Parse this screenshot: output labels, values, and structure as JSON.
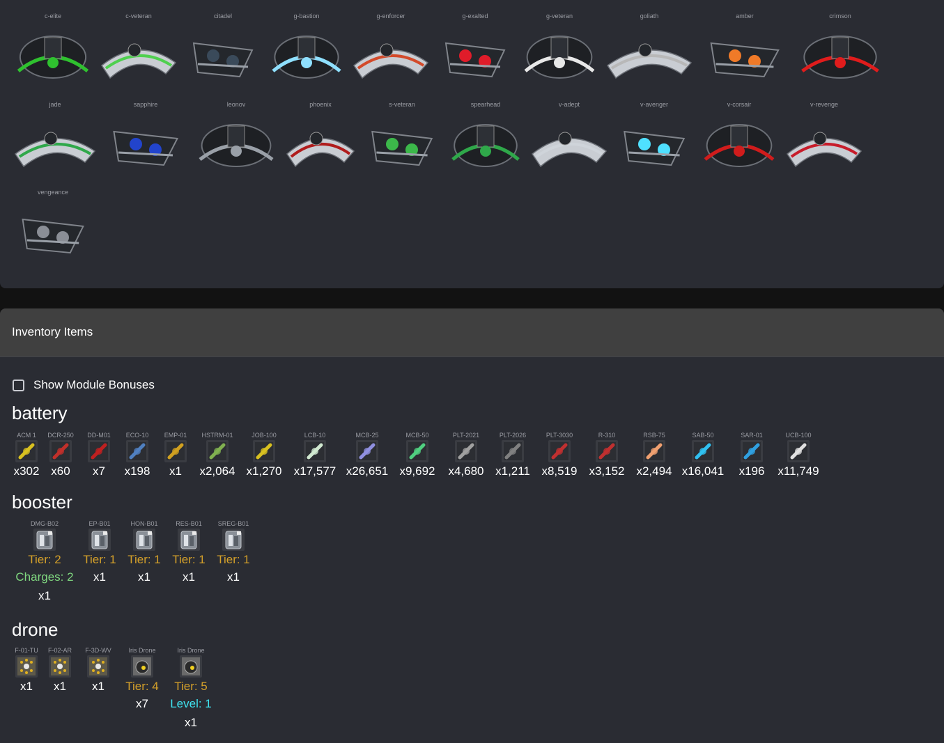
{
  "colors": {
    "panel": "#2a2c33",
    "header": "#404040",
    "tier": "#d4a02a",
    "charges": "#7fd67f",
    "level": "#3fe3f0"
  },
  "ships": {
    "row1": [
      {
        "name": "c-elite",
        "icon": "ship-icon",
        "accent": "#2fc12f"
      },
      {
        "name": "c-veteran",
        "icon": "ship-icon",
        "accent": "#4fd04f"
      },
      {
        "name": "citadel",
        "icon": "ship-icon",
        "accent": "#3a4a5a"
      },
      {
        "name": "g-bastion",
        "icon": "ship-icon",
        "accent": "#8fe0ff"
      },
      {
        "name": "g-enforcer",
        "icon": "ship-icon",
        "accent": "#d34a2a"
      },
      {
        "name": "g-exalted",
        "icon": "ship-icon",
        "accent": "#e01c2a"
      },
      {
        "name": "g-veteran",
        "icon": "ship-icon",
        "accent": "#e8e8e8"
      },
      {
        "name": "goliath",
        "icon": "ship-icon",
        "accent": "#b8b8b8"
      },
      {
        "name": "amber",
        "icon": "ship-icon",
        "accent": "#f07a28"
      },
      {
        "name": "crimson",
        "icon": "ship-icon",
        "accent": "#e01c1c"
      }
    ],
    "row2": [
      {
        "name": "jade",
        "icon": "ship-icon",
        "accent": "#2fa84a"
      },
      {
        "name": "sapphire",
        "icon": "ship-icon",
        "accent": "#2244cc"
      },
      {
        "name": "leonov",
        "icon": "ship-icon",
        "accent": "#9aa0a8"
      },
      {
        "name": "phoenix",
        "icon": "ship-icon",
        "accent": "#b01c1c"
      },
      {
        "name": "s-veteran",
        "icon": "ship-icon",
        "accent": "#3cb84a"
      },
      {
        "name": "spearhead",
        "icon": "ship-icon",
        "accent": "#2fa84a"
      },
      {
        "name": "v-adept",
        "icon": "ship-icon",
        "accent": "#cfd4da"
      },
      {
        "name": "v-avenger",
        "icon": "ship-icon",
        "accent": "#4fe0ff"
      },
      {
        "name": "v-corsair",
        "icon": "ship-icon",
        "accent": "#d01c1c"
      },
      {
        "name": "v-revenge",
        "icon": "ship-icon",
        "accent": "#c81c2a"
      }
    ],
    "row3": [
      {
        "name": "vengeance",
        "icon": "ship-icon",
        "accent": "#8a8e96"
      }
    ]
  },
  "inventory": {
    "title": "Inventory Items",
    "show_bonuses_label": "Show Module Bonuses",
    "battery": {
      "title": "battery",
      "items": [
        {
          "label": "ACM 1",
          "qty": "x302",
          "icon": "battery-icon",
          "color": "#d8c020"
        },
        {
          "label": "DCR-250",
          "qty": "x60",
          "icon": "battery-icon",
          "color": "#c0302a"
        },
        {
          "label": "DD-M01",
          "qty": "x7",
          "icon": "battery-icon",
          "color": "#c02020"
        },
        {
          "label": "ECO-10",
          "qty": "x198",
          "icon": "battery-icon",
          "color": "#5080c0"
        },
        {
          "label": "EMP-01",
          "qty": "x1",
          "icon": "battery-icon",
          "color": "#d0a020"
        },
        {
          "label": "HSTRM-01",
          "qty": "x2,064",
          "icon": "battery-icon",
          "color": "#80b050"
        },
        {
          "label": "JOB-100",
          "qty": "x1,270",
          "icon": "battery-icon",
          "color": "#d8c020"
        },
        {
          "label": "LCB-10",
          "qty": "x17,577",
          "icon": "battery-icon",
          "color": "#d0e8d0"
        },
        {
          "label": "MCB-25",
          "qty": "x26,651",
          "icon": "battery-icon",
          "color": "#9090e0"
        },
        {
          "label": "MCB-50",
          "qty": "x9,692",
          "icon": "battery-icon",
          "color": "#50d080"
        },
        {
          "label": "PLT-2021",
          "qty": "x4,680",
          "icon": "battery-icon",
          "color": "#a0a0a0"
        },
        {
          "label": "PLT-2026",
          "qty": "x1,211",
          "icon": "battery-icon",
          "color": "#808080"
        },
        {
          "label": "PLT-3030",
          "qty": "x8,519",
          "icon": "battery-icon",
          "color": "#c03030"
        },
        {
          "label": "R-310",
          "qty": "x3,152",
          "icon": "battery-icon",
          "color": "#c03030"
        },
        {
          "label": "RSB-75",
          "qty": "x2,494",
          "icon": "battery-icon",
          "color": "#f0a070"
        },
        {
          "label": "SAB-50",
          "qty": "x16,041",
          "icon": "battery-icon",
          "color": "#30c0f0"
        },
        {
          "label": "SAR-01",
          "qty": "x196",
          "icon": "battery-icon",
          "color": "#30a0e0"
        },
        {
          "label": "UCB-100",
          "qty": "x11,749",
          "icon": "battery-icon",
          "color": "#e0e0e0"
        }
      ]
    },
    "booster": {
      "title": "booster",
      "items": [
        {
          "label": "DMG-B02",
          "tier": "Tier: 2",
          "extra": "Charges: 2",
          "qty": "x1",
          "icon": "booster-icon"
        },
        {
          "label": "EP-B01",
          "tier": "Tier: 1",
          "qty": "x1",
          "icon": "booster-icon"
        },
        {
          "label": "HON-B01",
          "tier": "Tier: 1",
          "qty": "x1",
          "icon": "booster-icon"
        },
        {
          "label": "RES-B01",
          "tier": "Tier: 1",
          "qty": "x1",
          "icon": "booster-icon"
        },
        {
          "label": "SREG-B01",
          "tier": "Tier: 1",
          "qty": "x1",
          "icon": "booster-icon"
        }
      ]
    },
    "drone": {
      "title": "drone",
      "items": [
        {
          "label": "F-01-TU",
          "qty": "x1",
          "icon": "formation-icon"
        },
        {
          "label": "F-02-AR",
          "qty": "x1",
          "icon": "formation-icon"
        },
        {
          "label": "F-3D-WV",
          "qty": "x1",
          "icon": "formation-icon"
        },
        {
          "label": "Iris Drone",
          "tier": "Tier: 4",
          "qty": "x7",
          "icon": "drone-icon"
        },
        {
          "label": "Iris Drone",
          "tier": "Tier: 5",
          "extra": "Level: 1",
          "qty": "x1",
          "icon": "drone-icon"
        }
      ]
    }
  }
}
